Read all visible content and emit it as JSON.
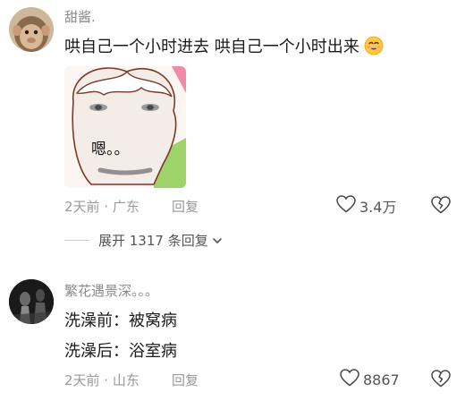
{
  "comments": [
    {
      "username": "甜酱.",
      "text": "哄自己一个小时进去 哄自己一个小时出来",
      "emoji": "grinning-face-emoji",
      "sticker_text": "嗯。。",
      "meta": "2天前 · 广东",
      "reply_label": "回复",
      "likes": "3.4万",
      "expand_label": "展开 1317 条回复"
    },
    {
      "username": "繁花遇景深。。。",
      "lines": [
        "洗澡前：被窝病",
        "洗澡后：浴室病"
      ],
      "meta": "2天前 · 山东",
      "reply_label": "回复",
      "likes": "8867"
    }
  ],
  "icons": {
    "like": "heart-outline-icon",
    "dislike": "broken-heart-icon",
    "expand": "chevron-down-icon"
  }
}
